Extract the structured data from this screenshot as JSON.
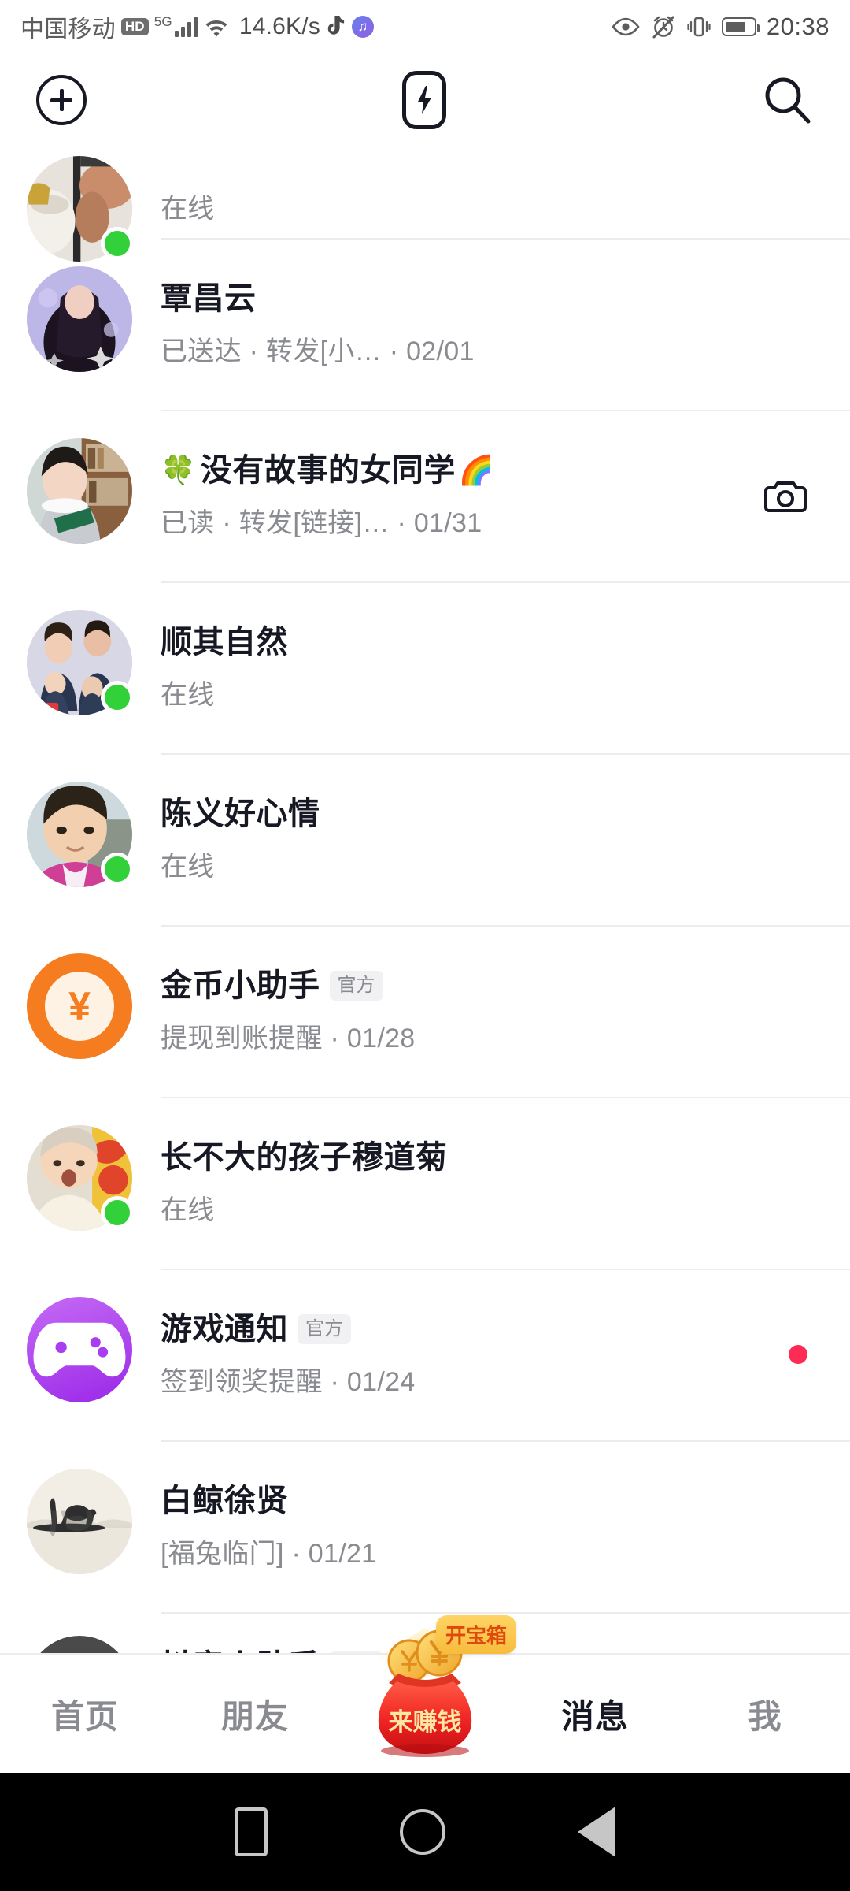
{
  "status_bar": {
    "carrier": "中国移动",
    "hd_badge": "HD",
    "network_type": "5G",
    "network_speed": "14.6K/s",
    "icons": [
      "tiktok-icon",
      "music-icon",
      "eye-icon",
      "alarm-off-icon",
      "vibrate-icon",
      "battery-icon"
    ],
    "time": "20:38"
  },
  "top_bar": {
    "add_label": "plus-circle-icon",
    "flash_label": "flash-icon",
    "search_label": "search-icon"
  },
  "colors": {
    "accent_red": "#fe2c55",
    "online_green": "#32d13a",
    "text_primary": "#161823",
    "text_secondary": "#8a8b91",
    "coin_orange": "#f57c1f",
    "game_purple": "#9b27e8",
    "treasure_yellow": "#f7bc3c"
  },
  "conversations": [
    {
      "name": "",
      "subtitle": "在线",
      "online": true,
      "badge": "",
      "date": "",
      "avatar": "photo-hand-cup",
      "right_icon": "",
      "unread": false,
      "partial": "top"
    },
    {
      "name": "覃昌云",
      "subtitle": "已送达 · 转发[小…   · 02/01",
      "online": false,
      "badge": "",
      "date": "02/01",
      "avatar": "photo-anime-girl",
      "right_icon": "",
      "unread": false
    },
    {
      "name": "没有故事的女同学",
      "prefix_emoji": "🍀",
      "suffix_emoji": "🌈",
      "subtitle": "已读 · 转发[链接]…  · 01/31",
      "online": false,
      "badge": "",
      "date": "01/31",
      "avatar": "photo-girl-reading",
      "right_icon": "camera-icon",
      "unread": false
    },
    {
      "name": "顺其自然",
      "subtitle": "在线",
      "online": true,
      "badge": "",
      "date": "",
      "avatar": "photo-family",
      "right_icon": "",
      "unread": false
    },
    {
      "name": "陈义好心情",
      "subtitle": "在线",
      "online": true,
      "badge": "",
      "date": "",
      "avatar": "photo-boy",
      "right_icon": "",
      "unread": false
    },
    {
      "name": "金币小助手",
      "subtitle": "提现到账提醒  · 01/28",
      "online": false,
      "badge": "官方",
      "date": "01/28",
      "avatar": "coin-yen-icon",
      "right_icon": "",
      "unread": false
    },
    {
      "name": "长不大的孩子穆道菊",
      "subtitle": "在线",
      "online": true,
      "badge": "",
      "date": "",
      "avatar": "photo-baby",
      "right_icon": "",
      "unread": false
    },
    {
      "name": "游戏通知",
      "subtitle": "签到领奖提醒 · 01/24",
      "online": false,
      "badge": "官方",
      "date": "01/24",
      "avatar": "game-controller-icon",
      "right_icon": "",
      "unread": true
    },
    {
      "name": "白鲸徐贤",
      "subtitle": "[福兔临门] · 01/21",
      "online": false,
      "badge": "",
      "date": "01/21",
      "avatar": "photo-horse-ink",
      "right_icon": "",
      "unread": false
    },
    {
      "name": "抖音小助手",
      "subtitle": "",
      "online": false,
      "badge": "官方",
      "date": "",
      "avatar": "photo-dark",
      "right_icon": "",
      "unread": false,
      "partial": "bottom"
    }
  ],
  "bottom_nav": {
    "items": [
      {
        "label": "首页",
        "active": false
      },
      {
        "label": "朋友",
        "active": false
      },
      {
        "label": "消息",
        "active": true
      },
      {
        "label": "我",
        "active": false
      }
    ],
    "money_bag": {
      "label": "来赚钱",
      "badge": "开宝箱"
    }
  },
  "android_nav": {
    "recents": "recents-square-icon",
    "home": "home-circle-icon",
    "back": "back-triangle-icon"
  }
}
